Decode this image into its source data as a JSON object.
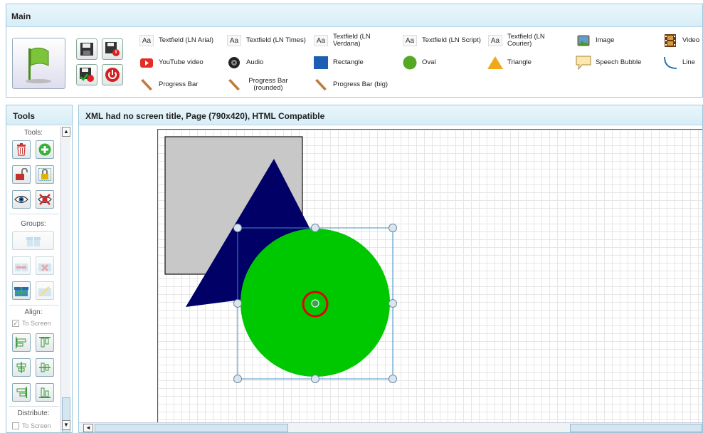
{
  "main": {
    "title": "Main",
    "widgets": [
      {
        "label": "Textfield (LN Arial)",
        "icon": "textfield-icon"
      },
      {
        "label": "Textfield (LN Times)",
        "icon": "textfield-icon"
      },
      {
        "label": "Textfield (LN Verdana)",
        "icon": "textfield-icon"
      },
      {
        "label": "Textfield (LN Script)",
        "icon": "textfield-icon"
      },
      {
        "label": "Textfield (LN Courier)",
        "icon": "textfield-icon"
      },
      {
        "label": "Image",
        "icon": "image-icon"
      },
      {
        "label": "Video",
        "icon": "video-icon"
      },
      {
        "label": "YouTube video",
        "icon": "youtube-icon"
      },
      {
        "label": "Audio",
        "icon": "audio-icon"
      },
      {
        "label": "Rectangle",
        "icon": "rectangle-icon"
      },
      {
        "label": "Oval",
        "icon": "oval-icon"
      },
      {
        "label": "Triangle",
        "icon": "triangle-icon"
      },
      {
        "label": "Speech Bubble",
        "icon": "speech-bubble-icon"
      },
      {
        "label": "Line",
        "icon": "line-icon"
      },
      {
        "label": "Progress Bar",
        "icon": "progress-bar-icon"
      },
      {
        "label": "Progress Bar (rounded)",
        "icon": "progress-bar-icon"
      },
      {
        "label": "Progress Bar (big)",
        "icon": "progress-bar-icon"
      }
    ],
    "aa_glyph": "Aa"
  },
  "tools": {
    "title": "Tools",
    "sections": {
      "tools": "Tools:",
      "groups": "Groups:",
      "align": "Align:",
      "distribute": "Distribute:"
    },
    "to_screen": "To Screen",
    "to_screen_checked": true,
    "to_screen_2_checked": false
  },
  "canvas": {
    "title": "XML had no screen title, Page (790x420), HTML Compatible"
  },
  "colors": {
    "rect_fill": "#c8c8c8",
    "triangle_fill": "#000066",
    "oval_fill": "#00c800",
    "selection": "#3f8fc4",
    "highlight_ring": "#e00000"
  }
}
